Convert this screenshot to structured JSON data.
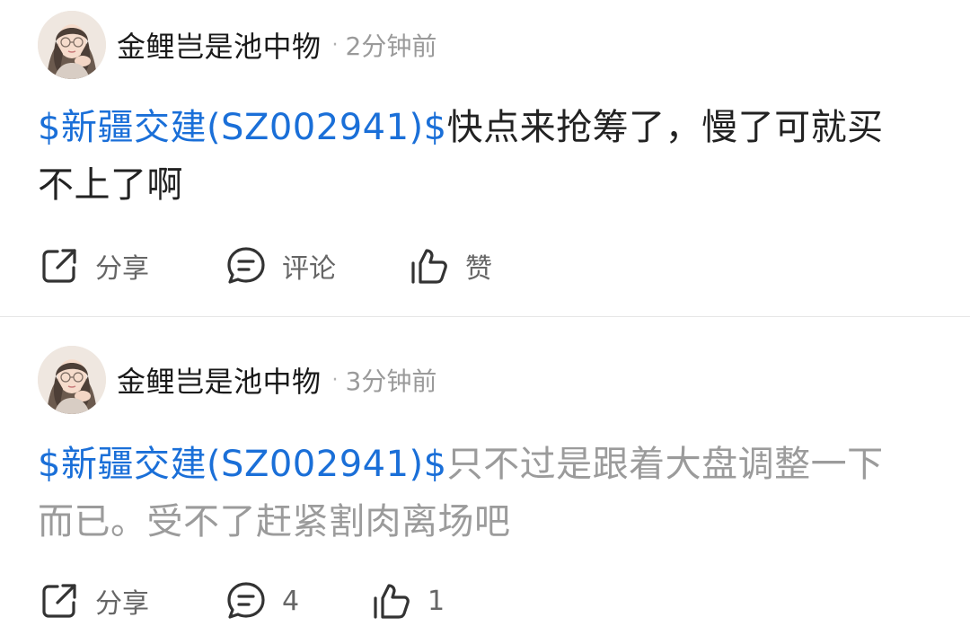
{
  "posts": [
    {
      "author": "金鲤岂是池中物",
      "separator": "·",
      "time": "2分钟前",
      "stock_tag": "$新疆交建(SZ002941)$",
      "text": "快点来抢筹了，慢了可就买不上了啊",
      "actions": {
        "share": "分享",
        "comment": "评论",
        "like": "赞"
      }
    },
    {
      "author": "金鲤岂是池中物",
      "separator": "·",
      "time": "3分钟前",
      "stock_tag": "$新疆交建(SZ002941)$",
      "text": "只不过是跟着大盘调整一下而已。受不了赶紧割肉离场吧",
      "actions": {
        "share": "分享",
        "comment": "4",
        "like": "1"
      }
    }
  ],
  "colors": {
    "link": "#1a6fd8",
    "primary_text": "#222222",
    "muted_text": "#9b9b9b",
    "icon": "#333333"
  },
  "icons": {
    "share": "share-icon",
    "comment": "comment-icon",
    "like": "like-icon"
  }
}
